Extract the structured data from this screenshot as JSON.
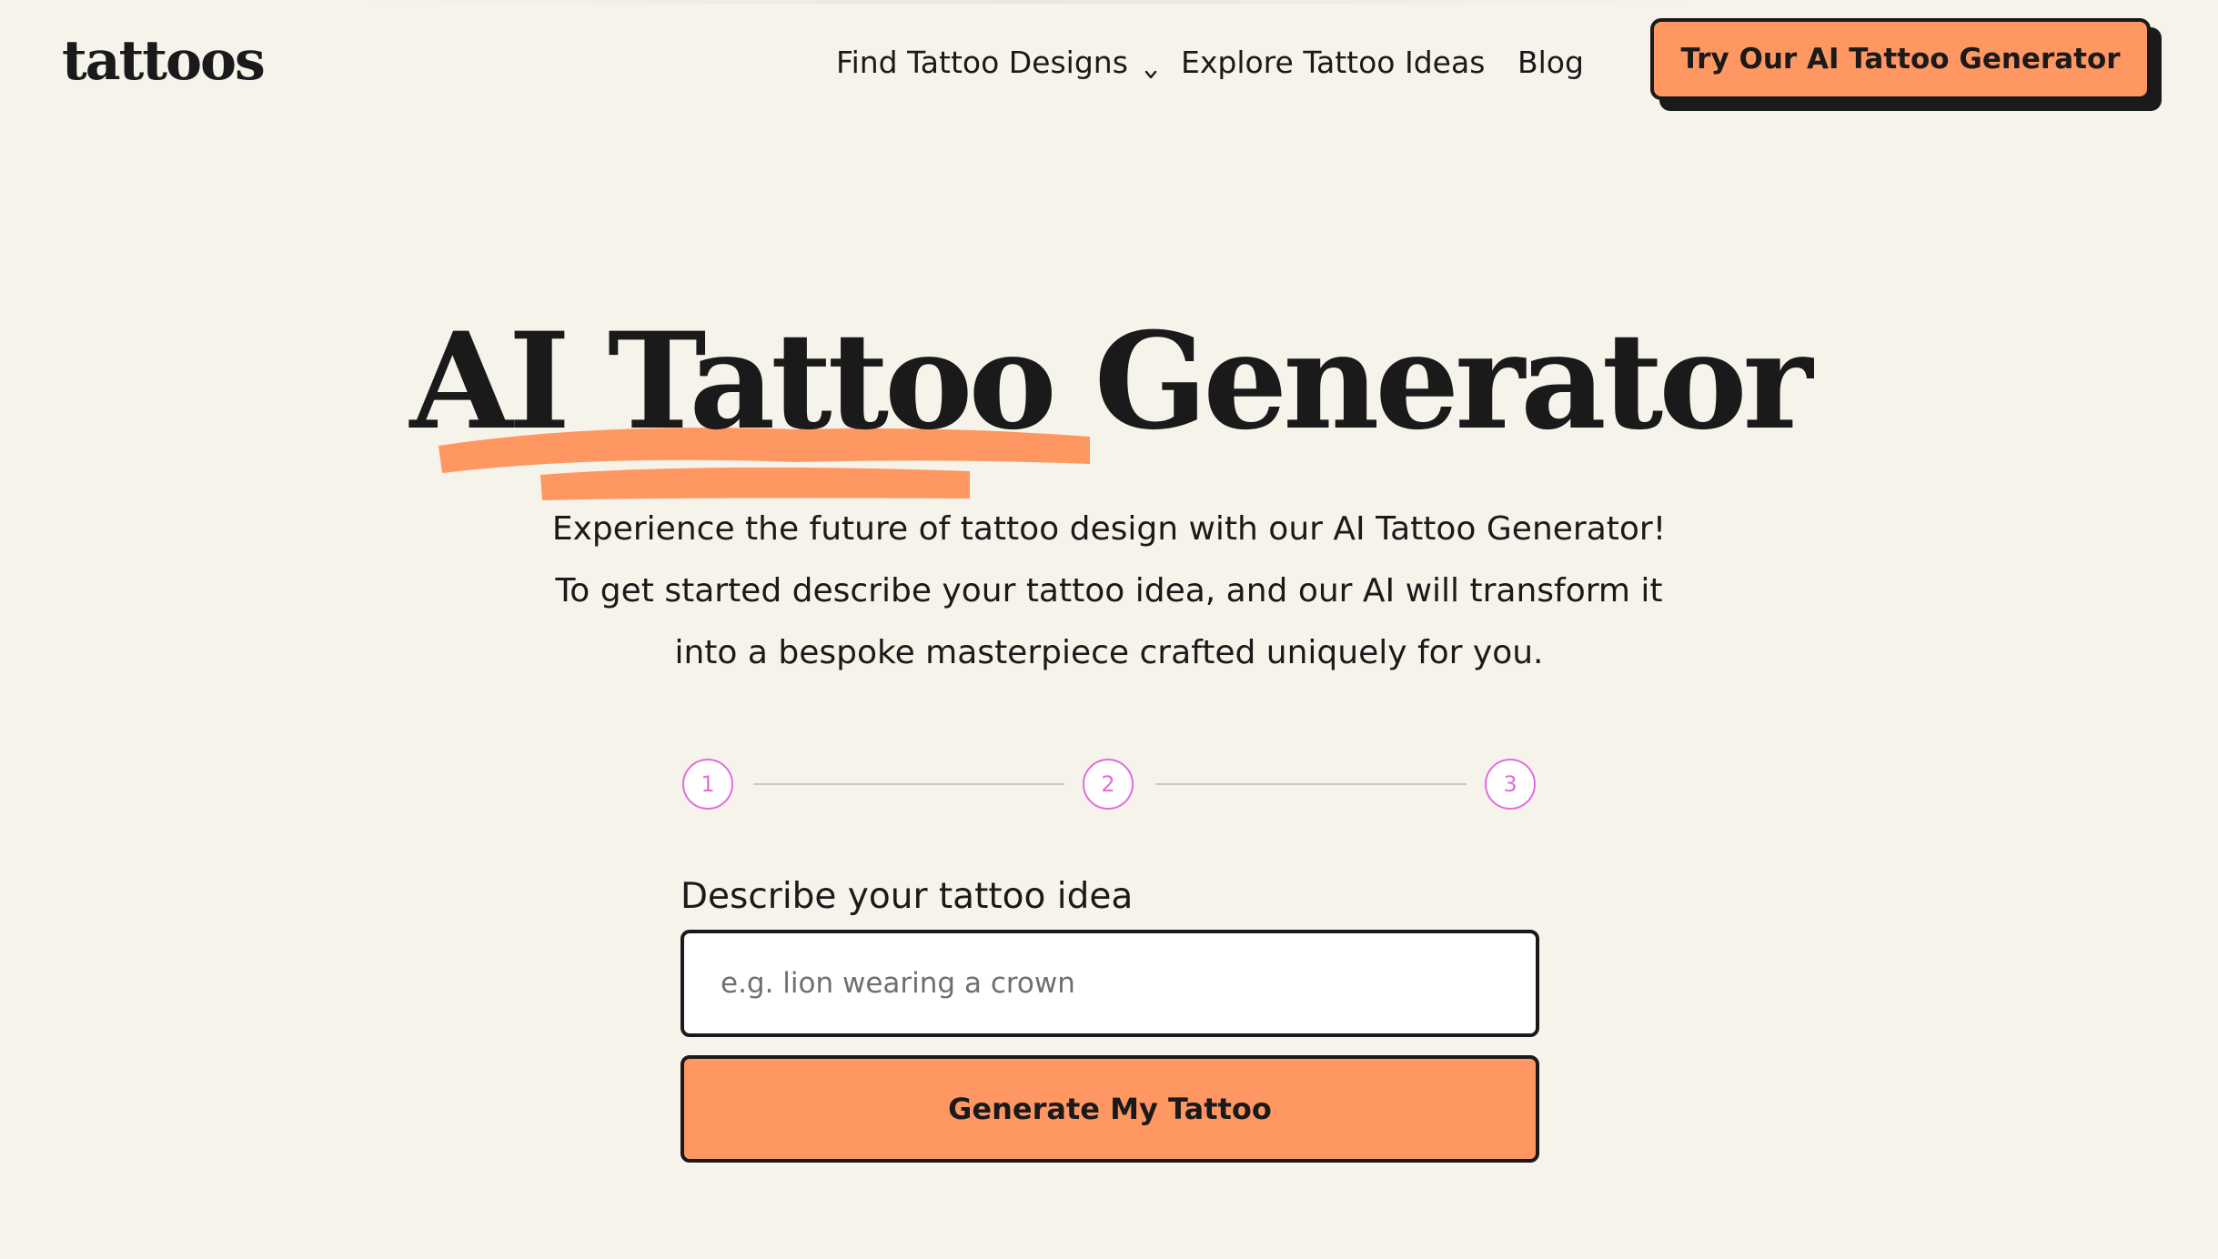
{
  "header": {
    "logo": "tattoos",
    "nav": {
      "find_designs": "Find Tattoo Designs",
      "explore_ideas": "Explore Tattoo Ideas",
      "blog": "Blog"
    },
    "cta_label": "Try Our AI Tattoo Generator"
  },
  "hero": {
    "title": "AI Tattoo Generator",
    "subtitle_lines": [
      "Experience the future of tattoo design with our AI Tattoo Generator!",
      "To get started describe your tattoo idea, and our AI will transform it",
      "into a bespoke masterpiece crafted uniquely for you."
    ]
  },
  "stepper": {
    "steps": [
      "1",
      "2",
      "3"
    ],
    "current_step": 1
  },
  "form": {
    "label": "Describe your tattoo idea",
    "input_value": "",
    "input_placeholder": "e.g. lion wearing a crown",
    "submit_label": "Generate My Tattoo"
  },
  "icons": {
    "nav_dropdown": "chevron-down-icon"
  },
  "colors": {
    "background": "#F6F3EB",
    "accent": "#FF9762",
    "text": "#1A1A1A",
    "step_accent": "#E56BDE"
  }
}
